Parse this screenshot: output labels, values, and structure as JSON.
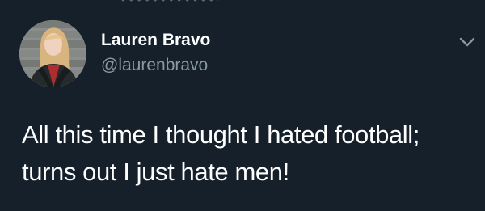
{
  "profile": {
    "display_name": "Lauren Bravo",
    "handle": "@laurenbravo"
  },
  "tweet": {
    "lines": [
      "All this time I thought I hated football;",
      "turns out I just hate men!"
    ]
  },
  "icons": {
    "avatar": "profile-photo",
    "menu": "chevron-down-icon"
  },
  "colors": {
    "background": "#15202b",
    "primary_text": "#ffffff",
    "secondary_text": "#8899a6"
  }
}
